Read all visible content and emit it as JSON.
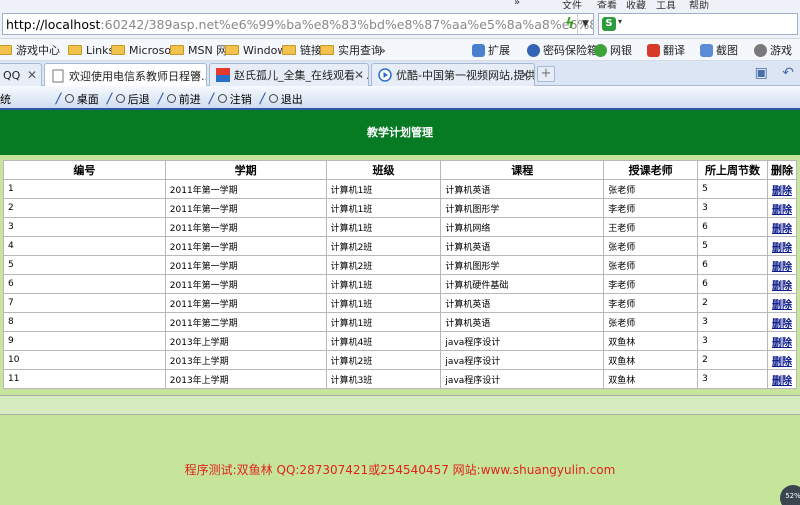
{
  "browser": {
    "top_menu": [
      "文件",
      "查看",
      "收藏",
      "工具",
      "帮助"
    ],
    "address": {
      "host": "http://localhost",
      "rest": ":60242/389asp.net%e6%99%ba%e8%83%bd%e8%87%aa%e5%8a%a8%e6%8e%92%"
    },
    "favorites": [
      "游戏中心",
      "Links",
      "Microso",
      "MSN 网",
      "Window",
      "链接",
      "实用查询"
    ],
    "favorites_more": "»",
    "right_tools": [
      "扩展",
      "密码保险箱",
      "网银",
      "翻译",
      "截图",
      "游戏"
    ],
    "tabs": [
      {
        "label": "QQ",
        "active": false
      },
      {
        "label": "欢迎使用电信系教师日程管...",
        "active": true
      },
      {
        "label": "赵氏孤儿_全集_在线观看 - ...",
        "active": false
      },
      {
        "label": "优酷-中国第一视频网站,提供...",
        "active": false
      }
    ],
    "icons": {
      "bolt": "lightning-icon",
      "dropdown": "chevron-down-icon",
      "search_engine": "search-engine-icon"
    }
  },
  "nav": {
    "edge": "统",
    "buttons": [
      "桌面",
      "后退",
      "前进",
      "注销",
      "退出"
    ]
  },
  "page": {
    "title": "教学计划管理",
    "footer": "程序测试:双鱼林 QQ:287307421或254540457 网站:www.shuangyulin.com",
    "corner_badge": "52%"
  },
  "table": {
    "headers": [
      "编号",
      "学期",
      "班级",
      "课程",
      "授课老师",
      "所上周节数",
      "删除"
    ],
    "delete_label": "删除",
    "rows": [
      [
        "1",
        "2011年第一学期",
        "计算机1班",
        "计算机英语",
        "张老师",
        "5"
      ],
      [
        "2",
        "2011年第一学期",
        "计算机1班",
        "计算机图形学",
        "李老师",
        "3"
      ],
      [
        "3",
        "2011年第一学期",
        "计算机1班",
        "计算机网络",
        "王老师",
        "6"
      ],
      [
        "4",
        "2011年第一学期",
        "计算机2班",
        "计算机英语",
        "张老师",
        "5"
      ],
      [
        "5",
        "2011年第一学期",
        "计算机2班",
        "计算机图形学",
        "张老师",
        "6"
      ],
      [
        "6",
        "2011年第一学期",
        "计算机1班",
        "计算机硬件基础",
        "李老师",
        "6"
      ],
      [
        "7",
        "2011年第一学期",
        "计算机1班",
        "计算机英语",
        "李老师",
        "2"
      ],
      [
        "8",
        "2011年第二学期",
        "计算机1班",
        "计算机英语",
        "张老师",
        "3"
      ],
      [
        "9",
        "2013年上学期",
        "计算机4班",
        "java程序设计",
        "双鱼林",
        "3"
      ],
      [
        "10",
        "2013年上学期",
        "计算机2班",
        "java程序设计",
        "双鱼林",
        "2"
      ],
      [
        "11",
        "2013年上学期",
        "计算机3班",
        "java程序设计",
        "双鱼林",
        "3"
      ]
    ]
  },
  "colors": {
    "header_green": "#077a24",
    "page_bg": "#c7e59a",
    "footer_red": "#e0231c",
    "link_blue": "#0b1a8a"
  }
}
